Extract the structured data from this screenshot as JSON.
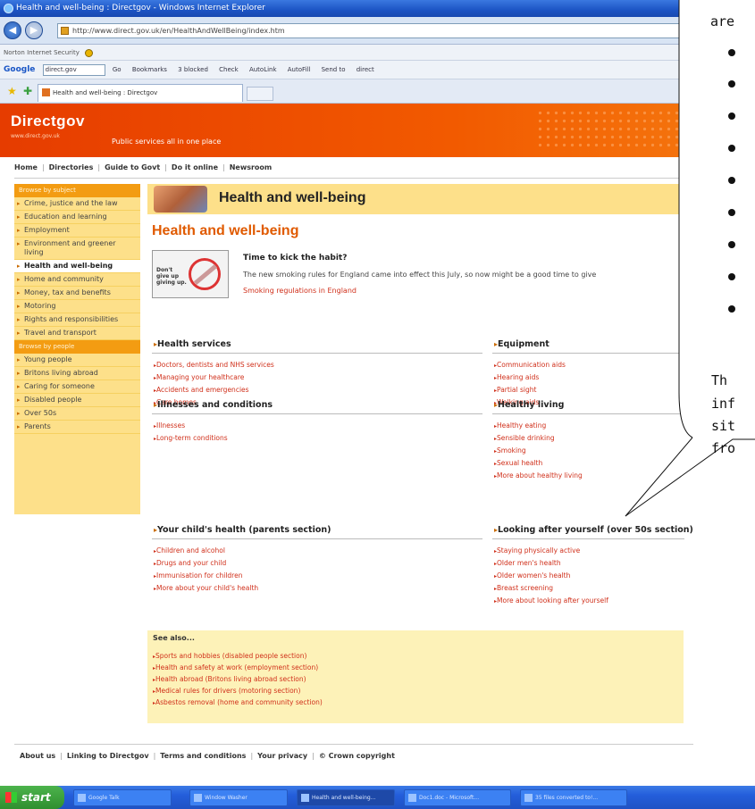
{
  "browser": {
    "title": "Health and well-being : Directgov - Windows Internet Explorer",
    "url": "http://www.direct.gov.uk/en/HealthAndWellBeing/index.htm",
    "norton_label": "Norton Internet Security",
    "google_label": "Google",
    "google_query": "direct.gov",
    "google_items": [
      "Go",
      "Bookmarks",
      "3 blocked",
      "Check",
      "AutoLink",
      "AutoFill",
      "Send to",
      "direct"
    ],
    "tab_title": "Health and well-being : Directgov"
  },
  "site": {
    "logo": "Directgov",
    "logo_sub": "www.direct.gov.uk",
    "tagline": "Public services all in one place",
    "topnav": [
      "Home",
      "Directories",
      "Guide to Govt",
      "Do it online",
      "Newsroom"
    ]
  },
  "leftnav": {
    "subject_head": "Browse by subject",
    "subject_items": [
      "Crime, justice and the law",
      "Education and learning",
      "Employment",
      "Environment and greener living",
      "Health and well-being",
      "Home and community",
      "Money, tax and benefits",
      "Motoring",
      "Rights and responsibilities",
      "Travel and transport"
    ],
    "people_head": "Browse by people",
    "people_items": [
      "Young people",
      "Britons living abroad",
      "Caring for someone",
      "Disabled people",
      "Over 50s",
      "Parents"
    ]
  },
  "main": {
    "banner_title": "Health and well-being",
    "page_title": "Health and well-being",
    "feature": {
      "thumb_text": "Don't give up giving up.",
      "title": "Time to kick the habit?",
      "body": "The new smoking rules for England came into effect this July, so now might be a good time to give",
      "link": "Smoking regulations in England"
    },
    "sections": {
      "health_services": {
        "title": "Health services",
        "links": [
          "Doctors, dentists and NHS services",
          "Managing your healthcare",
          "Accidents and emergencies",
          "Care homes"
        ]
      },
      "equipment": {
        "title": "Equipment",
        "links": [
          "Communication aids",
          "Hearing aids",
          "Partial sight",
          "Walking aids"
        ]
      },
      "illnesses": {
        "title": "Illnesses and conditions",
        "links": [
          "Illnesses",
          "Long-term conditions"
        ]
      },
      "healthy_living": {
        "title": "Healthy living",
        "links": [
          "Healthy eating",
          "Sensible drinking",
          "Smoking",
          "Sexual health",
          "More about healthy living"
        ]
      },
      "child_health": {
        "title": "Your child's health (parents section)",
        "links": [
          "Children and alcohol",
          "Drugs and your child",
          "Immunisation for children",
          "More about your child's health"
        ]
      },
      "looking_after": {
        "title": "Looking after yourself (over 50s section)",
        "links": [
          "Staying physically active",
          "Older men's health",
          "Older women's health",
          "Breast screening",
          "More about looking after yourself"
        ]
      }
    },
    "see_also": {
      "title": "See also...",
      "links": [
        "Sports and hobbies (disabled people section)",
        "Health and safety at work (employment section)",
        "Health abroad (Britons living abroad section)",
        "Medical rules for drivers (motoring section)",
        "Asbestos removal (home and community section)"
      ]
    }
  },
  "footer": [
    "About us",
    "Linking to Directgov",
    "Terms and conditions",
    "Your privacy",
    "© Crown copyright"
  ],
  "callout": {
    "top_fragment": "are",
    "lines": [
      "Th",
      "inf",
      "sit",
      "fro"
    ]
  },
  "taskbar": {
    "start_label": "start",
    "tasks": [
      "Google Talk",
      "Window Washer",
      "Health and well-being...",
      "Doc1.doc - Microsoft...",
      "35 files converted to!..."
    ]
  }
}
